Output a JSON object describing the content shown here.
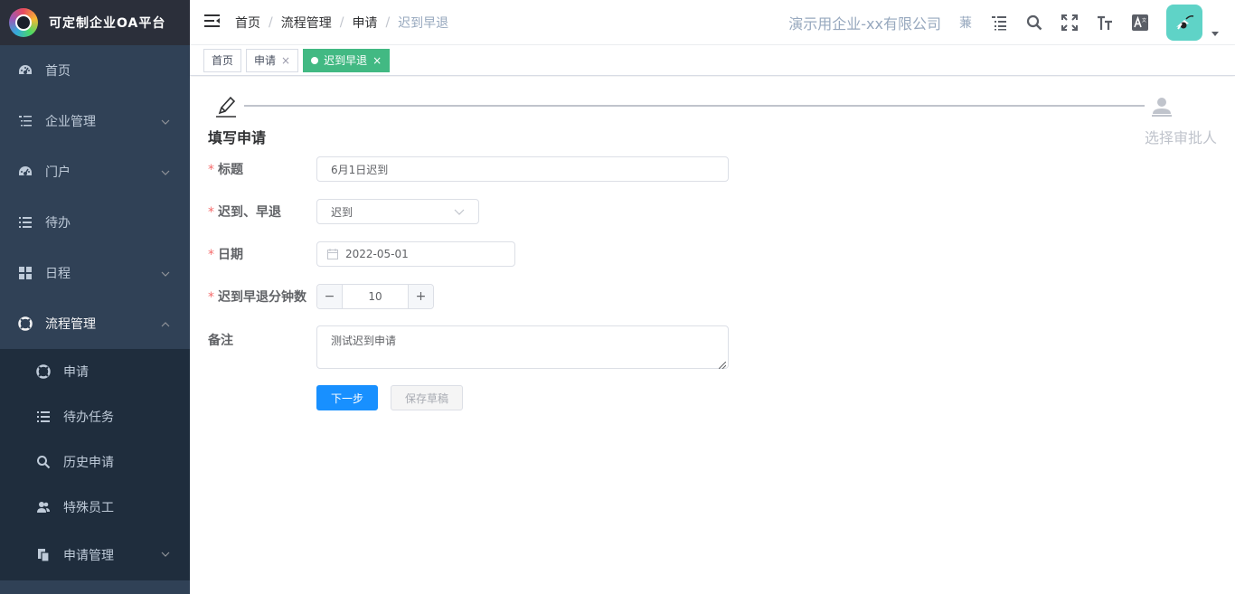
{
  "app": {
    "title": "可定制企业OA平台"
  },
  "sidebar": {
    "items": [
      {
        "label": "首页",
        "icon": "dashboard-icon"
      },
      {
        "label": "企业管理",
        "icon": "tree-list-icon"
      },
      {
        "label": "门户",
        "icon": "dashboard-icon"
      },
      {
        "label": "待办",
        "icon": "list-icon"
      },
      {
        "label": "日程",
        "icon": "grid-icon"
      },
      {
        "label": "流程管理",
        "icon": "lifebuoy-icon"
      }
    ],
    "sub_items": [
      {
        "label": "申请",
        "icon": "lifebuoy-icon"
      },
      {
        "label": "待办任务",
        "icon": "list-icon"
      },
      {
        "label": "历史申请",
        "icon": "search-icon"
      },
      {
        "label": "特殊员工",
        "icon": "users-icon"
      },
      {
        "label": "申请管理",
        "icon": "documents-icon"
      }
    ]
  },
  "navbar": {
    "breadcrumb": [
      "首页",
      "流程管理",
      "申请",
      "迟到早退"
    ],
    "company": "演示用企业-xx有限公司",
    "lang": "蒹"
  },
  "tags": [
    {
      "label": "首页"
    },
    {
      "label": "申请",
      "close": "×"
    },
    {
      "label": "迟到早退",
      "close": "×"
    }
  ],
  "steps": {
    "step1": "填写申请",
    "step2": "选择审批人"
  },
  "form": {
    "title_label": "标题",
    "title_value": "6月1日迟到",
    "type_label": "迟到、早退",
    "type_value": "迟到",
    "date_label": "日期",
    "date_value": "2022-05-01",
    "minutes_label": "迟到早退分钟数",
    "minutes_value": "10",
    "minus": "−",
    "plus": "+",
    "remark_label": "备注",
    "remark_value": "测试迟到申请",
    "required_mark": "*",
    "next_button": "下一步",
    "draft_button": "保存草稿"
  },
  "colors": {
    "sidebar_bg": "#304156",
    "active_tag": "#42b983",
    "primary": "#1890ff"
  }
}
